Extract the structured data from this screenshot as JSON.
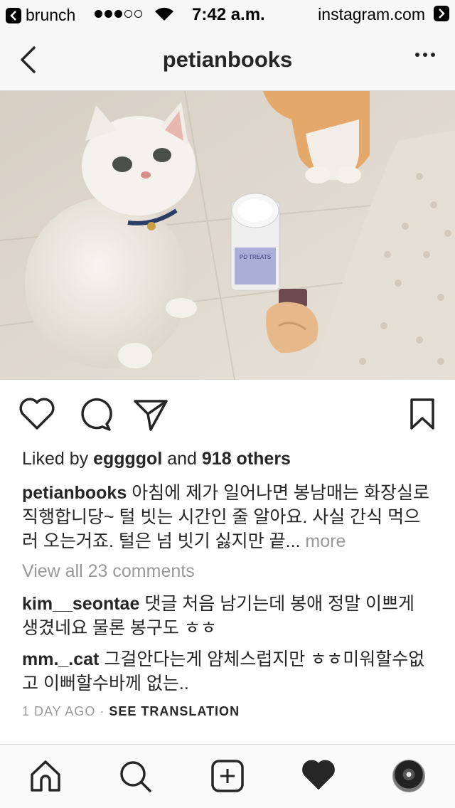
{
  "status_bar": {
    "back_app": "brunch",
    "time": "7:42 a.m.",
    "site": "instagram.com",
    "signal_filled": 3,
    "signal_total": 5
  },
  "nav": {
    "title": "petianbooks"
  },
  "post": {
    "likes_prefix": "Liked by ",
    "liked_by_user": "eggggol",
    "likes_middle": " and ",
    "likes_count": "918 others",
    "caption_user": "petianbooks",
    "caption_text": " 아침에 제가 일어나면 봉남매는 화장실로 직행합니당~ 털 빗는 시간인 줄 알아요. 사실 간식 먹으러 오는거죠. 털은 넘 빗기 싫지만 끝... ",
    "caption_more": "more",
    "view_all_comments": "View all 23 comments",
    "comments": [
      {
        "user": "kim__seontae",
        "text": " 댓글 처음 남기는데 봉애 정말 이쁘게 생겼네요 물론 봉구도 ㅎㅎ"
      },
      {
        "user": "mm._.cat",
        "text": " 그걸안다는게 얌체스럽지만 ㅎㅎ미워할수없고 이뻐할수바께 없는.."
      }
    ],
    "time_ago": "1 DAY AGO",
    "separator": " · ",
    "see_translation": "SEE TRANSLATION"
  },
  "photo_text": {
    "jar_label": "PD TREATS"
  },
  "icons": {
    "like": "heart-outline-icon",
    "comment": "speech-bubble-icon",
    "share": "paper-plane-icon",
    "save": "bookmark-icon",
    "home": "home-icon",
    "search": "search-icon",
    "add": "add-post-icon",
    "activity": "heart-filled-icon",
    "profile": "profile-avatar"
  },
  "colors": {
    "text": "#262626",
    "muted": "#999999",
    "bar_bg": "#f7f7f7"
  }
}
